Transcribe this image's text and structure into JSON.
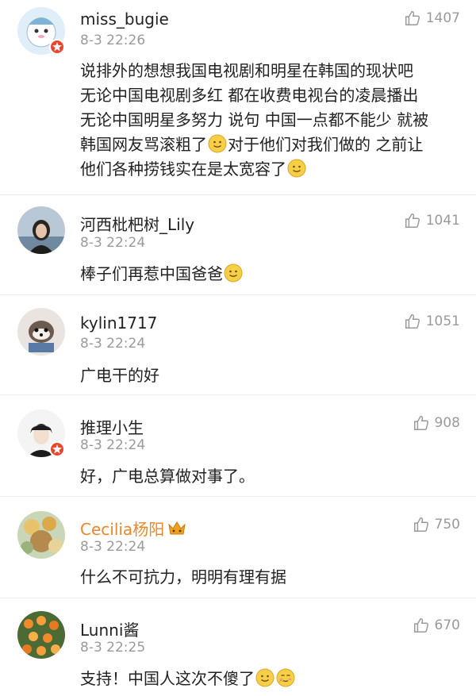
{
  "comments": [
    {
      "username": "miss_bugie",
      "time": "8-3 22:26",
      "likes": "1407",
      "lines": [
        "说排外的想想我国电视剧和明星在韩国的现状吧",
        "无论中国电视剧多红 都在收费电视台的凌晨播出",
        "无论中国明星多努力 说句 中国一点都不能少 就被",
        "韩国网友骂滚粗了",
        "对于他们对我们做的 之前让",
        "他们各种捞钱实在是太宽容了"
      ]
    },
    {
      "username": "河西枇杷树_Lily",
      "time": "8-3 22:24",
      "likes": "1041",
      "lines": [
        "棒子们再惹中国爸爸"
      ]
    },
    {
      "username": "kylin1717",
      "time": "8-3 22:24",
      "likes": "1051",
      "lines": [
        "广电干的好"
      ]
    },
    {
      "username": "推理小生",
      "time": "8-3 22:24",
      "likes": "908",
      "lines": [
        "好，广电总算做对事了。"
      ]
    },
    {
      "username": "Cecilia杨阳",
      "time": "8-3 22:24",
      "likes": "750",
      "lines": [
        "什么不可抗力，明明有理有据"
      ]
    },
    {
      "username": "Lunni酱",
      "time": "8-3 22:25",
      "likes": "670",
      "lines": [
        "支持！中国人这次不傻了"
      ]
    }
  ],
  "icons": {
    "like": "thumbs-up-icon",
    "verified": "verified-badge-icon",
    "emoji_smile": "smile-emoji-icon",
    "emoji_shy": "shy-emoji-icon",
    "vip": "vip-crown-icon"
  },
  "colors": {
    "username": "#222222",
    "vip_username": "#e8872b",
    "meta": "#9a9a9a",
    "badge": "#e8462f"
  }
}
